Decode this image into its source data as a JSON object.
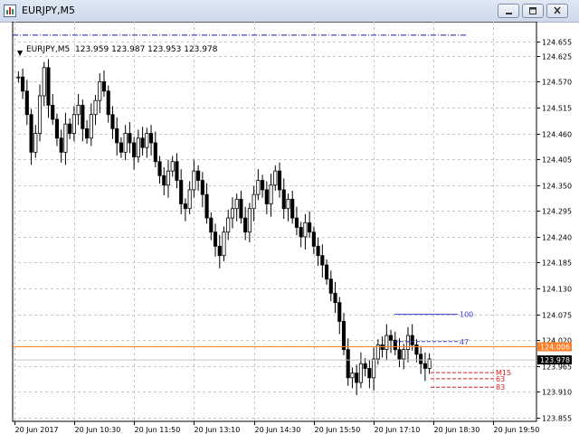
{
  "window": {
    "title": "EURJPY,M5",
    "buttons": [
      "minimize",
      "restore",
      "close"
    ]
  },
  "chart_header": {
    "symbol": "EURJPY,M5",
    "ohlc": "123.959 123.987 123.953 123.978"
  },
  "colors": {
    "background": "#ffffff",
    "grid": "#c8c8c8",
    "candle": "#000000",
    "bid_line": "#ff7f27",
    "price_tag": "#ff7f27",
    "last_tag": "#000000",
    "level_blue": "#3a3ad0",
    "level_red": "#d02020",
    "dashdot_top": "#1a1aa0"
  },
  "chart_data": {
    "type": "candlestick",
    "y_axis": {
      "ticks": [
        "124.655",
        "124.625",
        "124.570",
        "124.515",
        "124.460",
        "124.405",
        "124.350",
        "124.295",
        "124.240",
        "124.185",
        "124.130",
        "124.075",
        "124.020",
        "123.965",
        "123.910",
        "123.855"
      ],
      "range": [
        123.855,
        124.69
      ]
    },
    "x_axis": {
      "ticks": [
        "20 Jun 2017",
        "20 Jun 10:30",
        "20 Jun 11:50",
        "20 Jun 13:10",
        "20 Jun 14:30",
        "20 Jun 15:50",
        "20 Jun 17:10",
        "20 Jun 18:30",
        "20 Jun 19:50"
      ]
    },
    "price_tags": {
      "bid": "124.006",
      "last": "123.978"
    },
    "levels": [
      {
        "label": "100",
        "value": 124.075,
        "color": "#3a3ad0"
      },
      {
        "label": "47",
        "value": 124.017,
        "color": "#3a3ad0"
      },
      {
        "label": "M15",
        "value": 123.951,
        "color": "#d02020"
      },
      {
        "label": "63",
        "value": 123.938,
        "color": "#d02020"
      },
      {
        "label": "83",
        "value": 123.92,
        "color": "#d02020"
      }
    ],
    "top_line": 124.669,
    "candles_close": [
      124.58,
      124.55,
      124.5,
      124.42,
      124.46,
      124.54,
      124.6,
      124.52,
      124.49,
      124.45,
      124.42,
      124.48,
      124.46,
      124.5,
      124.52,
      124.47,
      124.45,
      124.5,
      124.53,
      124.57,
      124.55,
      124.5,
      124.47,
      124.44,
      124.42,
      124.46,
      124.44,
      124.41,
      124.45,
      124.43,
      124.46,
      124.44,
      124.4,
      124.37,
      124.35,
      124.38,
      124.4,
      124.36,
      124.31,
      124.3,
      124.34,
      124.38,
      124.36,
      124.33,
      124.28,
      124.25,
      124.22,
      124.2,
      124.25,
      124.28,
      124.3,
      124.32,
      124.28,
      124.25,
      124.3,
      124.33,
      124.36,
      124.34,
      124.31,
      124.35,
      124.38,
      124.34,
      124.3,
      124.32,
      124.28,
      124.26,
      124.24,
      124.27,
      124.25,
      124.22,
      124.2,
      124.18,
      124.15,
      124.12,
      124.1,
      124.06,
      124.0,
      123.94,
      123.95,
      123.93,
      123.97,
      123.96,
      123.94,
      123.98,
      124.01,
      124.0,
      124.03,
      124.02,
      124.0,
      123.98,
      124.0,
      124.03,
      124.01,
      123.99,
      123.97,
      123.96,
      123.98
    ]
  }
}
